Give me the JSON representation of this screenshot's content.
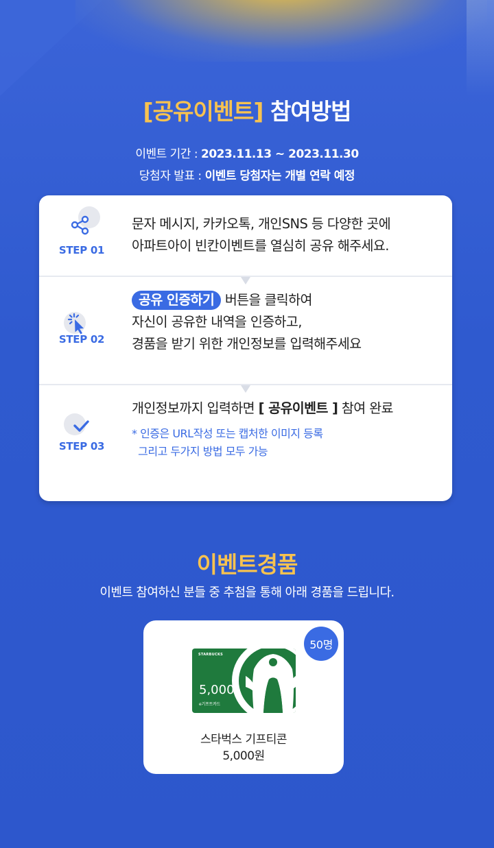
{
  "colors": {
    "background": "#2f5ad0",
    "accent_orange": "#f7c250",
    "accent_blue": "#3a6be3",
    "card_bg": "#ffffff"
  },
  "header": {
    "title_bracket": "[공유이벤트]",
    "title_main": "참여방법"
  },
  "info": {
    "period_label": "이벤트 기간 : ",
    "period_value": "2023.11.13 ~ 2023.11.30",
    "winner_label": "당첨자 발표 : ",
    "winner_value": "이벤트 당첨자는 개별 연락 예정"
  },
  "steps": [
    {
      "icon": "share-icon",
      "label": "STEP 01",
      "lines": [
        "문자 메시지, 카카오톡, 개인SNS 등 다양한 곳에",
        "아파트아이 빈칸이벤트를 열심히 공유 해주세요."
      ]
    },
    {
      "icon": "cursor-click-icon",
      "label": "STEP 02",
      "pill": "공유 인증하기",
      "line1_rest": " 버튼을 클릭하여",
      "lines": [
        "자신이 공유한 내역을 인증하고,",
        "경품을 받기 위한 개인정보를 입력해주세요"
      ]
    },
    {
      "icon": "check-icon",
      "label": "STEP 03",
      "line1_pre": "개인정보까지 입력하면 ",
      "line1_bold": "[ 공유이벤트 ]",
      "line1_post": " 참여 완료",
      "notes": [
        "* 인증은 URL작성 또는 캡처한 이미지 등록",
        "  그리고 두가지 방법 모두 가능"
      ]
    }
  ],
  "prize_section": {
    "title": "이벤트경품",
    "subtitle": "이벤트 참여하신 분들 중 추첨을 통해 아래 경품을 드립니다.",
    "count": "50명",
    "giftcard": {
      "brand": "STARBUCKS",
      "amount": "5,000",
      "sub": "e기프트카드"
    },
    "name": "스타벅스 기프티콘",
    "price": "5,000원"
  }
}
